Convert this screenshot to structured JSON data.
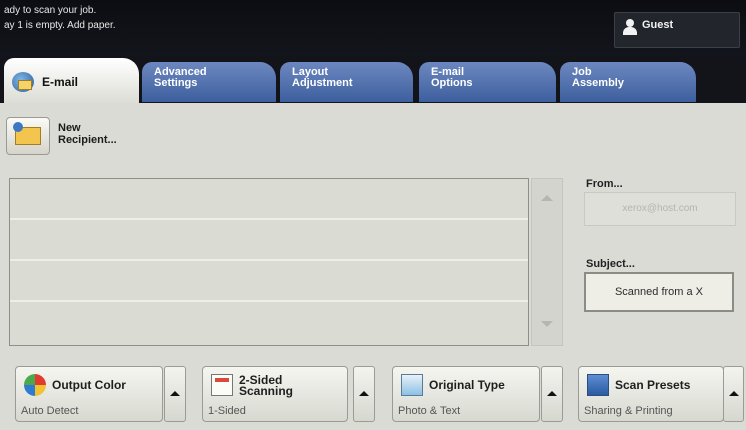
{
  "status": {
    "line1": "ady to scan your job.",
    "line2": "ay 1 is empty.  Add paper."
  },
  "user": {
    "label": "Guest",
    "icon": "user-icon"
  },
  "tabs": [
    {
      "label": "E-mail",
      "active": true,
      "icon": "email-icon"
    },
    {
      "label": "Advanced\nSettings",
      "active": false
    },
    {
      "label": "Layout\nAdjustment",
      "active": false
    },
    {
      "label": "E-mail\nOptions",
      "active": false
    },
    {
      "label": "Job\nAssembly",
      "active": false
    }
  ],
  "new_recipient": {
    "label": "New\nRecipient...",
    "icon": "new-recipient-icon"
  },
  "recipients": {
    "rows": [
      "",
      "",
      "",
      ""
    ]
  },
  "from": {
    "label": "From...",
    "value": "xerox@host.com"
  },
  "subject": {
    "label": "Subject...",
    "value": "Scanned from a X"
  },
  "features": [
    {
      "title": "Output Color",
      "value": "Auto Detect",
      "icon": "color-icon"
    },
    {
      "title": "2-Sided\nScanning",
      "value": "1-Sided",
      "icon": "two-sided-icon"
    },
    {
      "title": "Original Type",
      "value": "Photo & Text",
      "icon": "original-type-icon"
    },
    {
      "title": "Scan Presets",
      "value": "Sharing & Printing",
      "icon": "scan-presets-icon"
    }
  ],
  "colors": {
    "tab_blue": "#4f6fb0",
    "status_bg": "#101218",
    "panel_bg": "#dadbd4"
  }
}
